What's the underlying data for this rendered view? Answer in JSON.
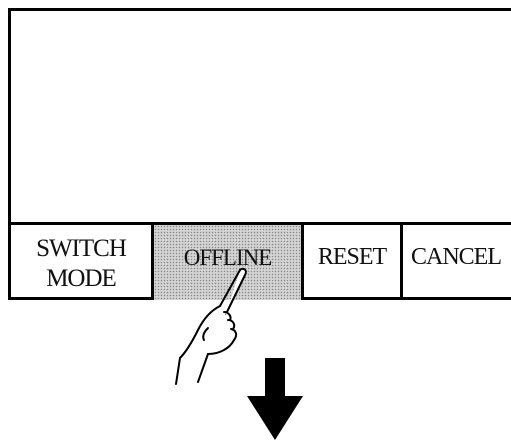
{
  "screen": {
    "buttons": [
      {
        "id": "switch_mode",
        "lines": [
          "SWITCH",
          "MODE"
        ],
        "pressed": false
      },
      {
        "id": "offline",
        "label": "OFFLINE",
        "pressed": true
      },
      {
        "id": "reset",
        "label": "RESET",
        "pressed": false
      },
      {
        "id": "cancel",
        "label": "CANCEL",
        "pressed": false
      }
    ]
  },
  "annotations": {
    "pointer_icon": "pointing-hand-icon",
    "next_step_icon": "down-arrow-icon"
  },
  "colors": {
    "border": "#000000",
    "pressed_fill": "#d4d4d4",
    "background": "#ffffff"
  }
}
